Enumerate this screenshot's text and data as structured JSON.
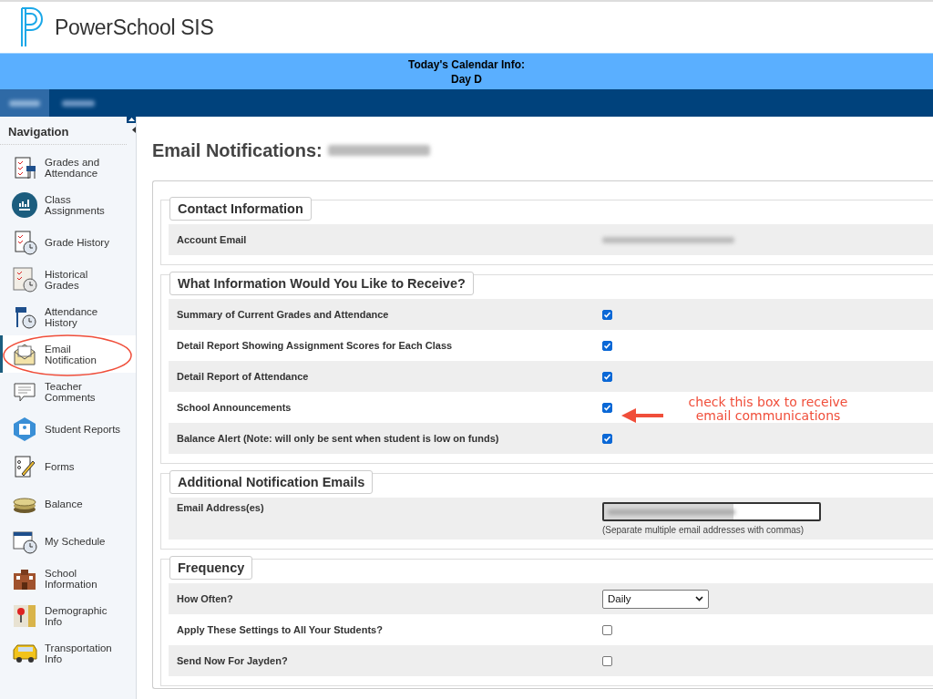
{
  "header": {
    "brand": "PowerSchool SIS"
  },
  "calendar": {
    "title": "Today's Calendar Info:",
    "day": "Day D"
  },
  "navigation": {
    "title": "Navigation",
    "items": [
      {
        "label": "Grades and Attendance",
        "selected": false
      },
      {
        "label": "Class Assignments",
        "selected": false
      },
      {
        "label": "Grade History",
        "selected": false
      },
      {
        "label": "Historical Grades",
        "selected": false
      },
      {
        "label": "Attendance History",
        "selected": false
      },
      {
        "label": "Email Notification",
        "selected": true
      },
      {
        "label": "Teacher Comments",
        "selected": false
      },
      {
        "label": "Student Reports",
        "selected": false
      },
      {
        "label": "Forms",
        "selected": false
      },
      {
        "label": "Balance",
        "selected": false
      },
      {
        "label": "My Schedule",
        "selected": false
      },
      {
        "label": "School Information",
        "selected": false
      },
      {
        "label": "Demographic Info",
        "selected": false
      },
      {
        "label": "Transportation Info",
        "selected": false
      }
    ]
  },
  "page_title": "Email Notifications:",
  "sections": [
    {
      "legend": "Contact Information",
      "rows": [
        {
          "kind": "value",
          "label": "Account Email"
        }
      ]
    },
    {
      "legend": "What Information Would You Like to Receive?",
      "rows": [
        {
          "kind": "checkbox",
          "label": "Summary of Current Grades and Attendance",
          "checked": true
        },
        {
          "kind": "checkbox",
          "label": "Detail Report Showing Assignment Scores for Each Class",
          "checked": true
        },
        {
          "kind": "checkbox",
          "label": "Detail Report of Attendance",
          "checked": true
        },
        {
          "kind": "checkbox",
          "label": "School Announcements",
          "checked": true
        },
        {
          "kind": "checkbox",
          "label": "Balance Alert (Note: will only be sent when student is low on funds)",
          "checked": true
        }
      ]
    },
    {
      "legend": "Additional Notification Emails",
      "rows": [
        {
          "kind": "input",
          "label": "Email Address(es)",
          "hint": "(Separate multiple email addresses with commas)"
        }
      ]
    },
    {
      "legend": "Frequency",
      "rows": [
        {
          "kind": "select",
          "label": "How Often?",
          "value": "Daily"
        },
        {
          "kind": "checkbox",
          "label": "Apply These Settings to All Your Students?",
          "checked": false
        },
        {
          "kind": "checkbox",
          "label": "Send Now For Jayden?",
          "checked": false
        }
      ]
    }
  ],
  "annotation": {
    "text": "check this box to receive email communications"
  }
}
